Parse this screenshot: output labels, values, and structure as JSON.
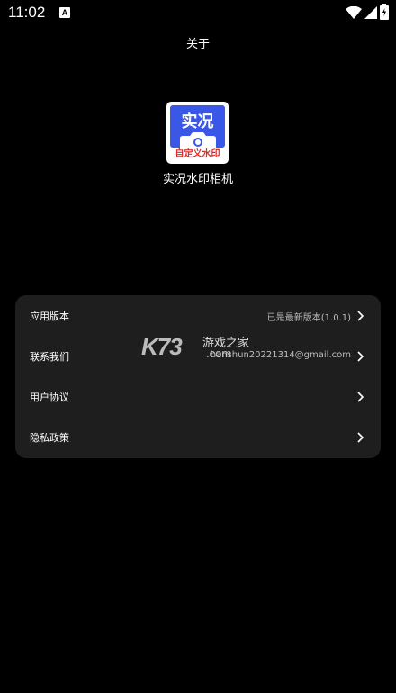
{
  "status_bar": {
    "time": "11:02",
    "notification_icon_letter": "A",
    "icons": [
      "wifi-icon",
      "signal-icon",
      "battery-icon"
    ]
  },
  "header": {
    "title": "关于"
  },
  "app": {
    "icon_word": "实况",
    "icon_stamp": "自定义水印",
    "name": "实况水印相机",
    "icon_colors": {
      "top": "#3a57e8",
      "stamp_text": "#e02a2a"
    }
  },
  "settings": {
    "items": [
      {
        "label": "应用版本",
        "value": "已是最新版本(1.0.1)"
      },
      {
        "label": "联系我们",
        "value": "hanshun20221314@gmail.com"
      },
      {
        "label": "用户协议",
        "value": ""
      },
      {
        "label": "隐私政策",
        "value": ""
      }
    ]
  },
  "watermark": {
    "logo": "K73",
    "text_cn": "游戏之家",
    "text_domain": ".com"
  },
  "colors": {
    "background": "#000000",
    "card": "#1e1e1e",
    "value_text": "#bdbdbd"
  }
}
